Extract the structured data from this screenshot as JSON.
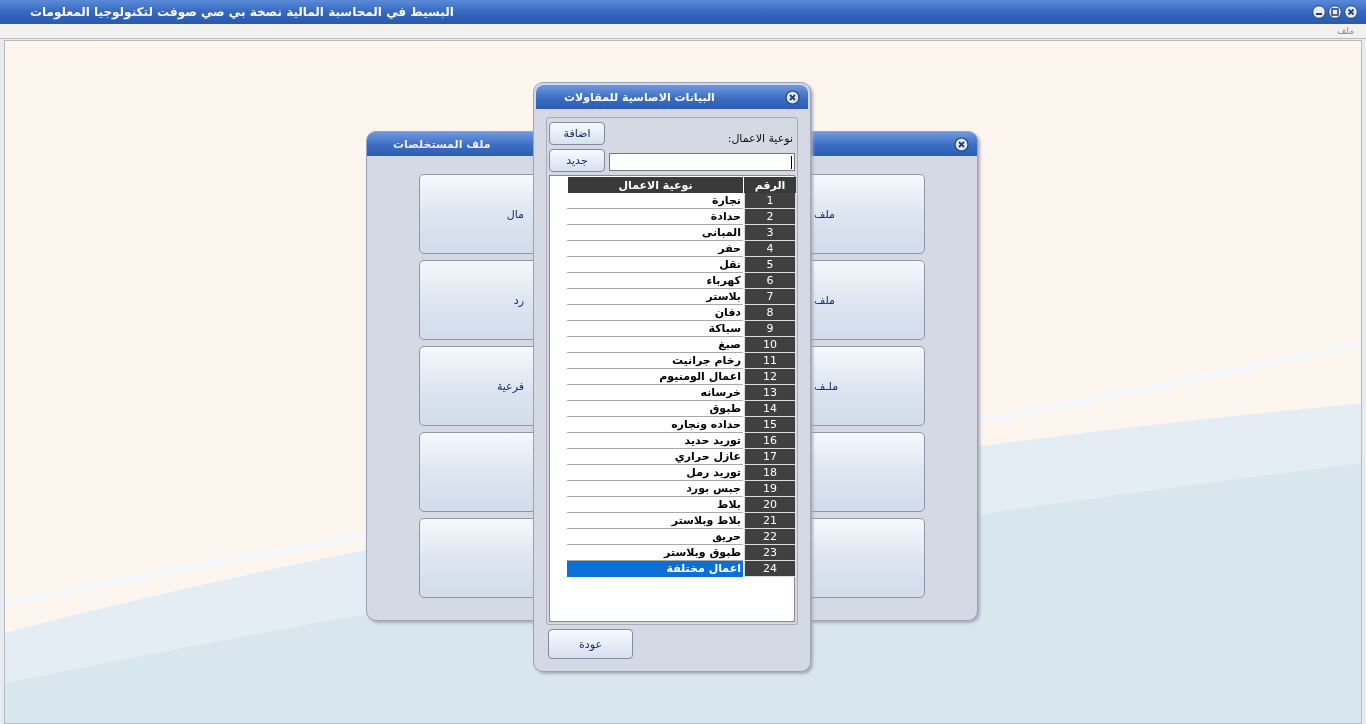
{
  "window": {
    "title": "البسيط في المحاسبة المالية  نصخة بي صي صوفت لتكنولوجيا المعلومات"
  },
  "menu": [
    {
      "label": "ملف"
    }
  ],
  "back_window": {
    "title": "ملف المستخلصات",
    "button_rows": [
      {
        "left": "مال",
        "right": "ملف"
      },
      {
        "left": "رد",
        "right": "ملف"
      },
      {
        "left": "فرعية",
        "right": "ملـف"
      },
      {},
      {}
    ]
  },
  "dialog": {
    "title": "البيانات الاصاسية للمقاولات",
    "add_button": "اضافة",
    "new_button": "جديد",
    "field_label": "نوعية الاعمال:",
    "columns": [
      "الرقم",
      "نوعية الاعمال"
    ],
    "rows": [
      {
        "number": "1",
        "type": "نجارة",
        "selected": false
      },
      {
        "number": "2",
        "type": "حدادة",
        "selected": false
      },
      {
        "number": "3",
        "type": "المبانى",
        "selected": false
      },
      {
        "number": "4",
        "type": "حفر",
        "selected": false
      },
      {
        "number": "5",
        "type": "نقل",
        "selected": false
      },
      {
        "number": "6",
        "type": "كهرباء",
        "selected": false
      },
      {
        "number": "7",
        "type": "بلاستر",
        "selected": false
      },
      {
        "number": "8",
        "type": "دفان",
        "selected": false
      },
      {
        "number": "9",
        "type": "سباكة",
        "selected": false
      },
      {
        "number": "10",
        "type": "صبغ",
        "selected": false
      },
      {
        "number": "11",
        "type": "رخام جرانيت",
        "selected": false
      },
      {
        "number": "12",
        "type": "اعمال الومنيوم",
        "selected": false
      },
      {
        "number": "13",
        "type": "خرسانه",
        "selected": false
      },
      {
        "number": "14",
        "type": "طبوق",
        "selected": false
      },
      {
        "number": "15",
        "type": "حداده ونجاره",
        "selected": false
      },
      {
        "number": "16",
        "type": "توريد حديد",
        "selected": false
      },
      {
        "number": "17",
        "type": "عازل حراري",
        "selected": false
      },
      {
        "number": "18",
        "type": "توريد رمل",
        "selected": false
      },
      {
        "number": "19",
        "type": "جبس بورد",
        "selected": false
      },
      {
        "number": "20",
        "type": "بلاط",
        "selected": false
      },
      {
        "number": "21",
        "type": "بلاط وبلاستر",
        "selected": false
      },
      {
        "number": "22",
        "type": "حريق",
        "selected": false
      },
      {
        "number": "23",
        "type": "طبوق وبلاستر",
        "selected": false
      },
      {
        "number": "24",
        "type": "اعمال مختلفة",
        "selected": true
      }
    ],
    "back_button": "عودة"
  }
}
